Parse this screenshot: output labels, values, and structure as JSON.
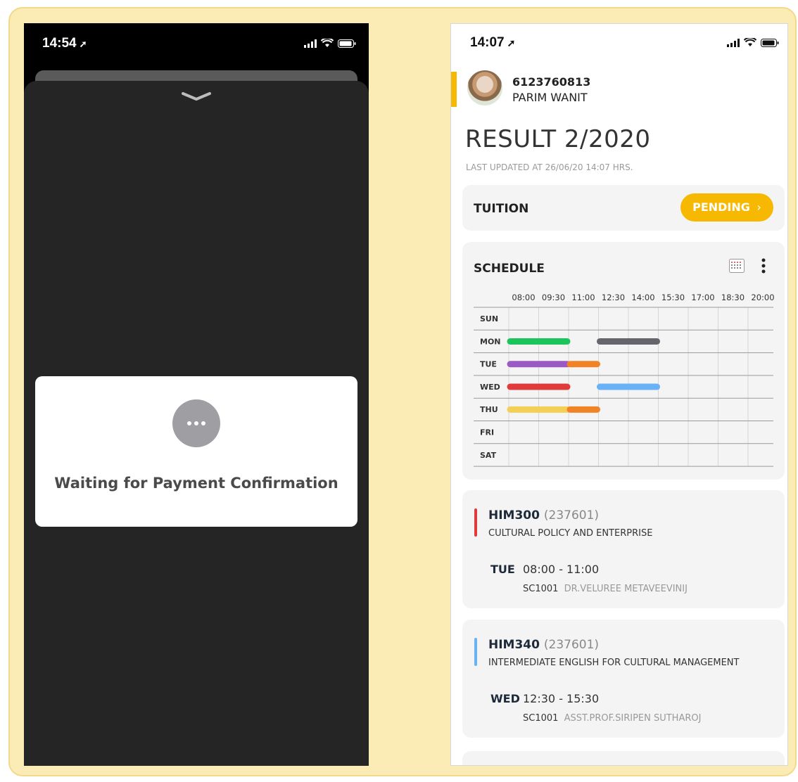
{
  "left_phone": {
    "time": "14:54",
    "modal_text": "Waiting for Payment Confirmation"
  },
  "right_phone": {
    "time": "14:07",
    "user": {
      "id": "6123760813",
      "name": "PARIM WANIT"
    },
    "title": "RESULT 2/2020",
    "last_updated": "LAST UPDATED AT 26/06/20 14:07 HRS.",
    "tuition": {
      "label": "TUITION",
      "status": "PENDING",
      "status_arrow": "›"
    },
    "schedule": {
      "label": "SCHEDULE",
      "times": [
        "08:00",
        "09:30",
        "11:00",
        "12:30",
        "14:00",
        "15:30",
        "17:00",
        "18:30",
        "20:00"
      ],
      "days": [
        "SUN",
        "MON",
        "TUE",
        "WED",
        "THU",
        "FRI",
        "SAT"
      ],
      "blocks": [
        {
          "day": "MON",
          "start": "08:00",
          "end": "11:00",
          "color": "#1cc45c"
        },
        {
          "day": "MON",
          "start": "12:30",
          "end": "15:30",
          "color": "#65656b"
        },
        {
          "day": "TUE",
          "start": "08:00",
          "end": "11:00",
          "color": "#9b59c4"
        },
        {
          "day": "TUE",
          "start": "11:00",
          "end": "12:30",
          "color": "#ef8326"
        },
        {
          "day": "WED",
          "start": "08:00",
          "end": "11:00",
          "color": "#e03a3a"
        },
        {
          "day": "WED",
          "start": "12:30",
          "end": "15:30",
          "color": "#6ab2f6"
        },
        {
          "day": "THU",
          "start": "08:00",
          "end": "11:00",
          "color": "#f4cf56"
        },
        {
          "day": "THU",
          "start": "11:00",
          "end": "12:30",
          "color": "#ef8326"
        }
      ]
    },
    "courses": [
      {
        "code": "HIM300",
        "section": "(237601)",
        "name": "CULTURAL POLICY AND ENTERPRISE",
        "day": "TUE",
        "time": "08:00 - 11:00",
        "room": "SC1001",
        "teacher": "DR.VELUREE METAVEEVINIJ",
        "color": "#e03a3a"
      },
      {
        "code": "HIM340",
        "section": "(237601)",
        "name": "INTERMEDIATE ENGLISH FOR CULTURAL MANAGEMENT",
        "day": "WED",
        "time": "12:30 - 15:30",
        "room": "SC1001",
        "teacher": "ASST.PROF.SIRIPEN SUTHAROJ",
        "color": "#6ab2f6"
      }
    ]
  }
}
